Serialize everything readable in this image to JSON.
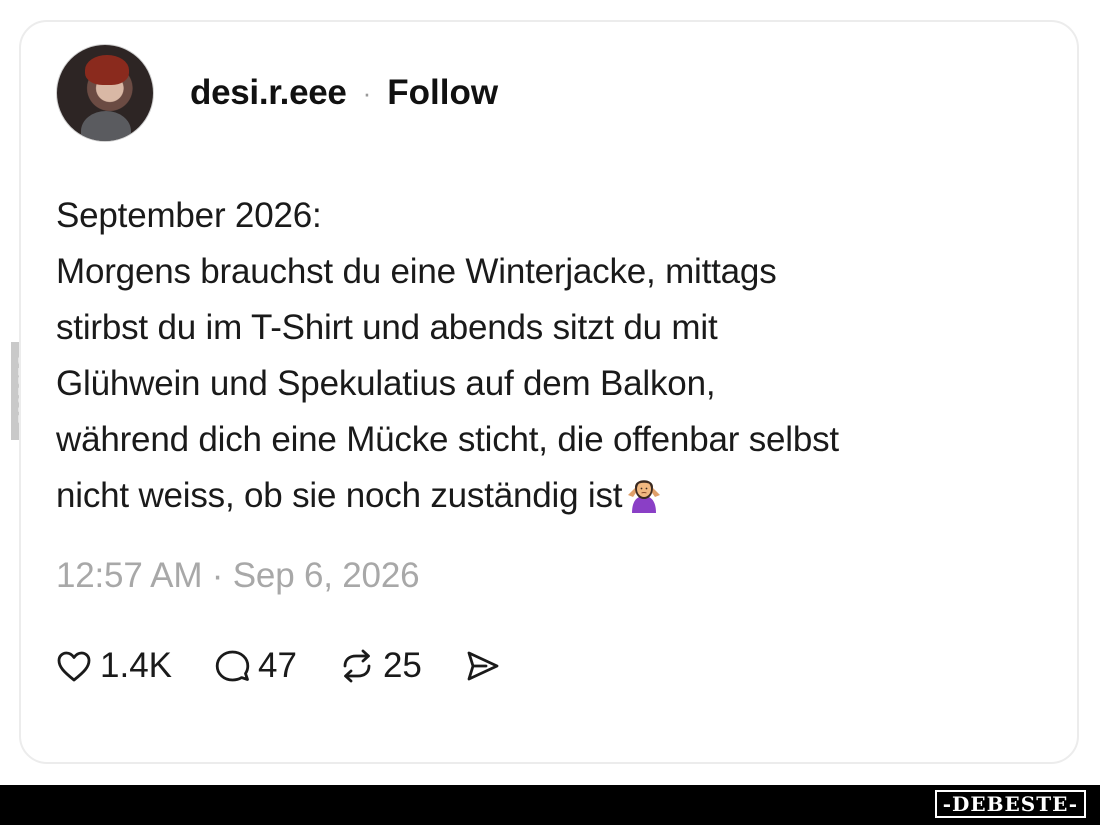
{
  "post": {
    "username": "desi.r.eee",
    "separator": "·",
    "follow_label": "Follow",
    "lines": [
      "September 2026:",
      "Morgens brauchst du eine Winterjacke, mittags",
      "stirbst du im T-Shirt und abends sitzt du mit",
      "Glühwein und Spekulatius auf dem Balkon,",
      "während dich eine Mücke sticht, die offenbar selbst",
      "nicht weiss, ob sie noch zuständig ist"
    ],
    "emoji": "person-shrugging-emoji",
    "timestamp": "12:57 AM · Sep 6, 2026"
  },
  "actions": {
    "likes": "1.4K",
    "comments": "47",
    "reposts": "25"
  },
  "watermark": {
    "brand": "-DEBESTE-",
    "side": "DEBESTE"
  }
}
